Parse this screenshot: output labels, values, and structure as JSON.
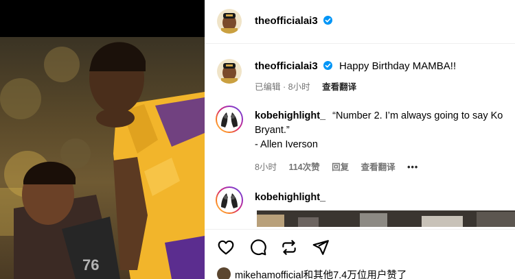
{
  "header": {
    "username": "theofficialai3"
  },
  "caption": {
    "username": "theofficialai3",
    "text": "Happy Birthday MAMBA!!",
    "edited": "已编辑",
    "separator": "·",
    "time": "8小时",
    "translate": "查看翻译"
  },
  "comments": [
    {
      "username": "kobehighlight_",
      "line1": "“Number 2. I’m always going to say Ko",
      "line2": "Bryant.”",
      "line3": "- Allen Iverson",
      "time": "8小时",
      "likes": "114次赞",
      "reply": "回复",
      "translate": "查看翻译",
      "more": "•••"
    },
    {
      "username": "kobehighlight_"
    }
  ],
  "likes_row": {
    "text": "mikehamofficial和其他7.4万位用户赞了"
  },
  "icons": [
    "verified-badge-icon",
    "heart-icon",
    "comment-icon",
    "repost-icon",
    "share-icon"
  ],
  "colors": {
    "verified": "#0095f6",
    "muted": "#737373",
    "lakers_gold": "#f5b82e"
  }
}
